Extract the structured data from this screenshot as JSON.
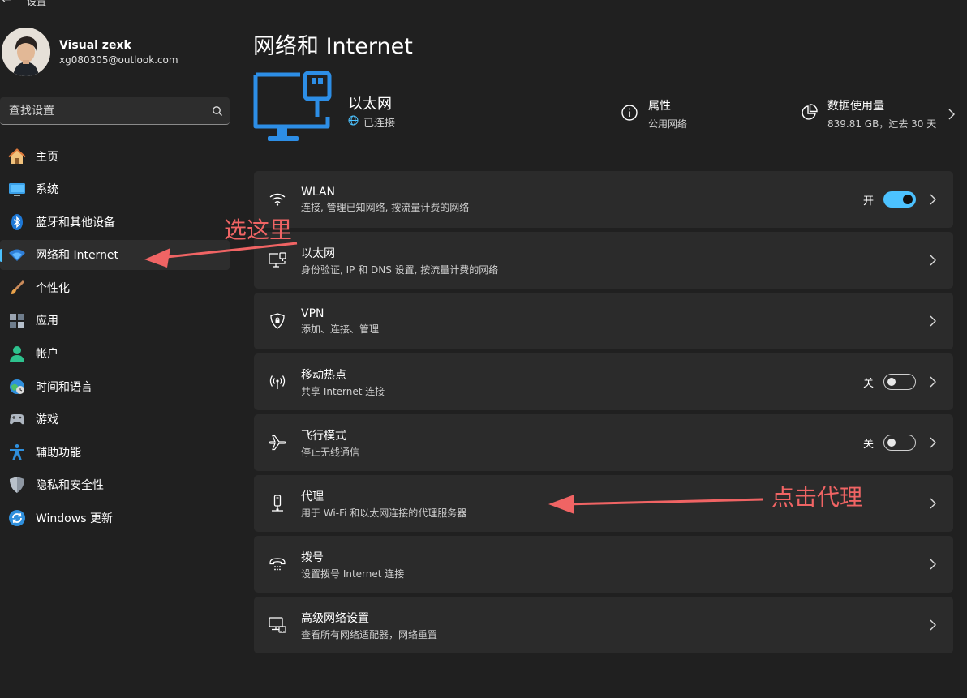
{
  "window": {
    "title": "设置"
  },
  "profile": {
    "name": "Visual zexk",
    "email": "xg080305@outlook.com"
  },
  "search": {
    "placeholder": "查找设置"
  },
  "nav": {
    "items": [
      {
        "label": "主页",
        "icon": "home-icon"
      },
      {
        "label": "系统",
        "icon": "system-icon"
      },
      {
        "label": "蓝牙和其他设备",
        "icon": "bluetooth-icon"
      },
      {
        "label": "网络和 Internet",
        "icon": "network-icon",
        "active": true
      },
      {
        "label": "个性化",
        "icon": "brush-icon"
      },
      {
        "label": "应用",
        "icon": "apps-icon"
      },
      {
        "label": "帐户",
        "icon": "account-icon"
      },
      {
        "label": "时间和语言",
        "icon": "time-language-icon"
      },
      {
        "label": "游戏",
        "icon": "gaming-icon"
      },
      {
        "label": "辅助功能",
        "icon": "accessibility-icon"
      },
      {
        "label": "隐私和安全性",
        "icon": "shield-icon"
      },
      {
        "label": "Windows 更新",
        "icon": "update-icon"
      }
    ]
  },
  "main": {
    "title": "网络和 Internet",
    "connection": {
      "name": "以太网",
      "status": "已连接"
    },
    "properties": {
      "title": "属性",
      "subtitle": "公用网络"
    },
    "data_usage": {
      "title": "数据使用量",
      "subtitle": "839.81 GB，过去 30 天"
    },
    "cards": [
      {
        "title": "WLAN",
        "subtitle": "连接, 管理已知网络, 按流量计费的网络",
        "icon": "wifi-icon",
        "toggle_label": "开",
        "toggle_on": true
      },
      {
        "title": "以太网",
        "subtitle": "身份验证, IP 和 DNS 设置, 按流量计费的网络",
        "icon": "ethernet-icon"
      },
      {
        "title": "VPN",
        "subtitle": "添加、连接、管理",
        "icon": "vpn-shield-icon"
      },
      {
        "title": "移动热点",
        "subtitle": "共享 Internet 连接",
        "icon": "hotspot-icon",
        "toggle_label": "关",
        "toggle_on": false
      },
      {
        "title": "飞行模式",
        "subtitle": "停止无线通信",
        "icon": "airplane-icon",
        "toggle_label": "关",
        "toggle_on": false
      },
      {
        "title": "代理",
        "subtitle": "用于 Wi-Fi 和以太网连接的代理服务器",
        "icon": "proxy-icon"
      },
      {
        "title": "拨号",
        "subtitle": "设置拨号 Internet 连接",
        "icon": "dialup-icon"
      },
      {
        "title": "高级网络设置",
        "subtitle": "查看所有网络适配器，网络重置",
        "icon": "advanced-network-icon"
      }
    ]
  },
  "annotations": {
    "select_here": "选这里",
    "click_proxy": "点击代理"
  },
  "colors": {
    "accent": "#4cc2ff",
    "annotation": "#f06464",
    "card_bg": "#2b2b2b",
    "page_bg": "#202020"
  }
}
